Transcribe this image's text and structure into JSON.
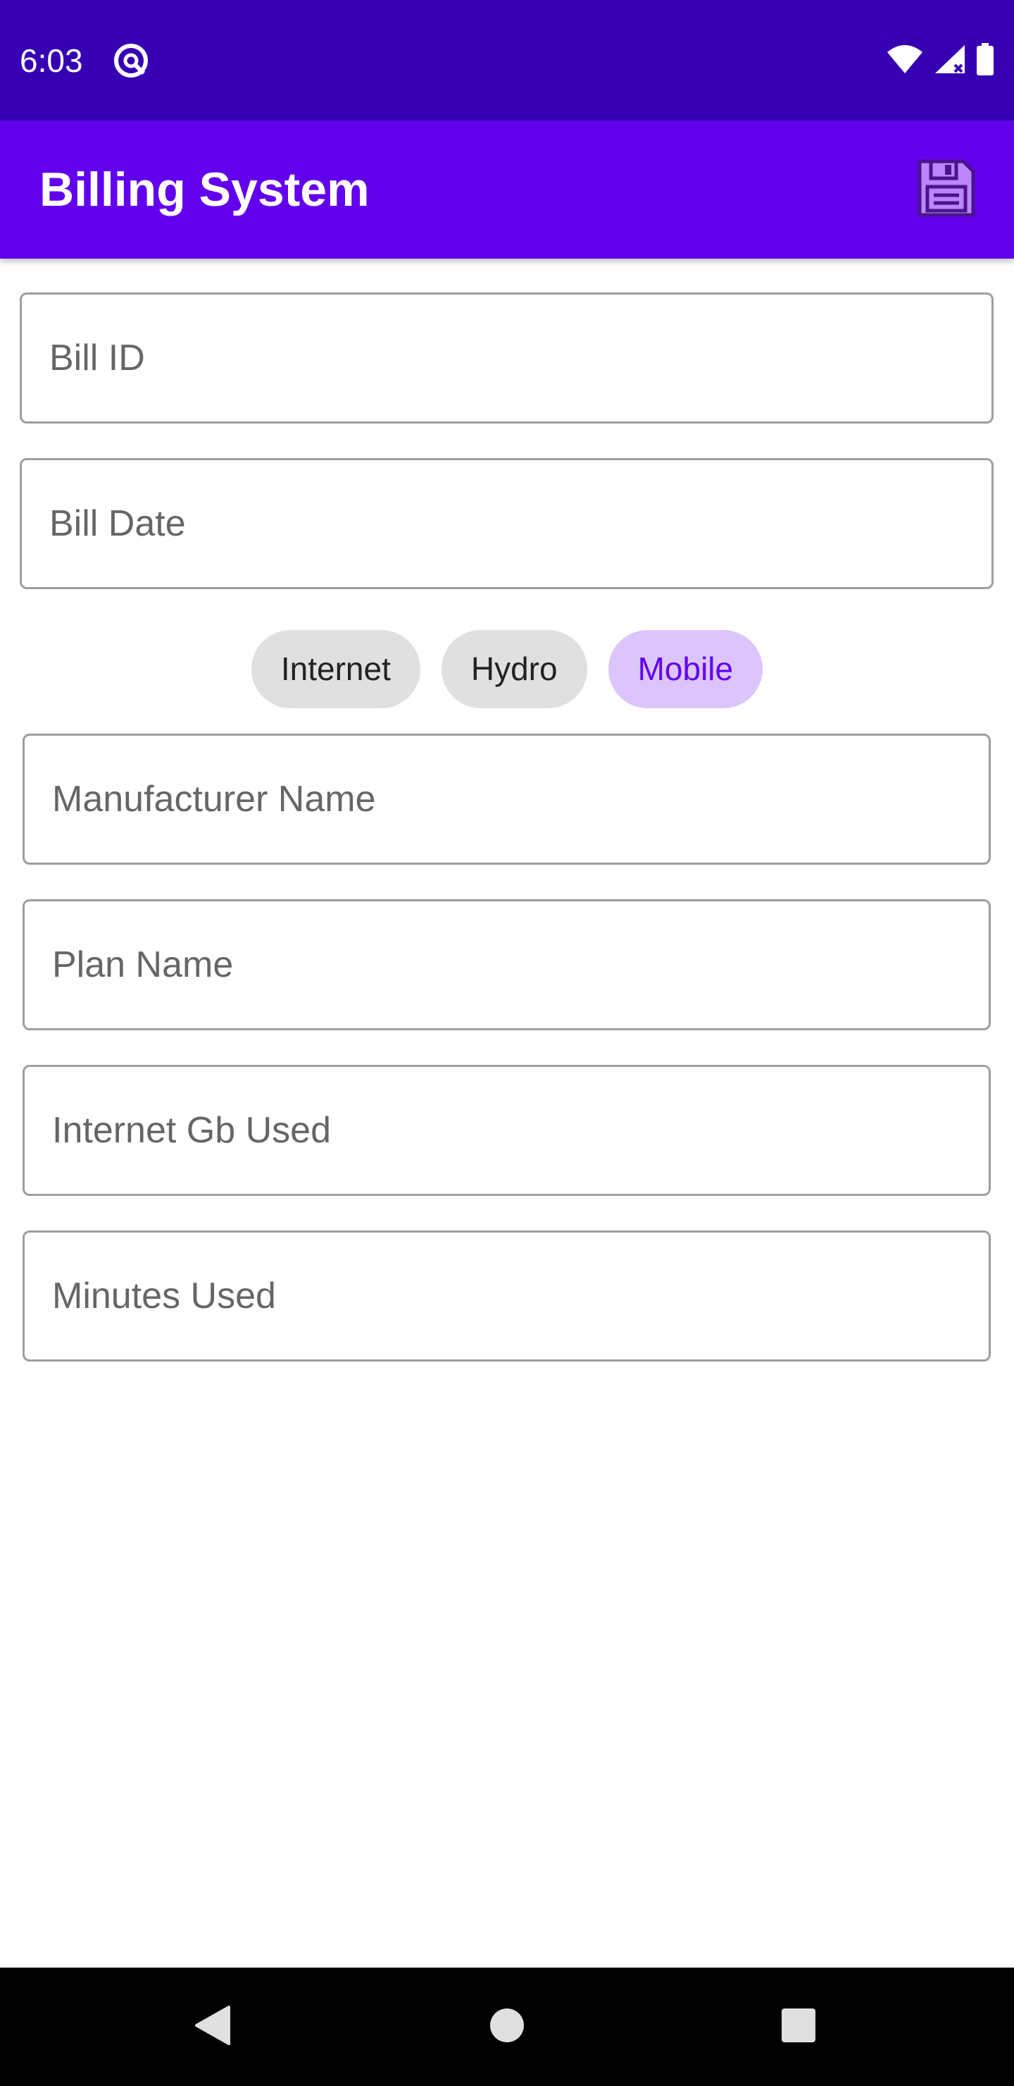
{
  "status_bar": {
    "time": "6:03"
  },
  "app_bar": {
    "title": "Billing System",
    "save_icon": "floppy-disk-save-icon"
  },
  "form": {
    "bill_id_placeholder": "Bill ID",
    "bill_date_placeholder": "Bill Date",
    "bill_types": [
      {
        "label": "Internet",
        "selected": false
      },
      {
        "label": "Hydro",
        "selected": false
      },
      {
        "label": "Mobile",
        "selected": true
      }
    ],
    "manufacturer_name_placeholder": "Manufacturer Name",
    "plan_name_placeholder": "Plan Name",
    "internet_gb_used_placeholder": "Internet Gb Used",
    "minutes_used_placeholder": "Minutes Used"
  },
  "colors": {
    "status_bar": "#3700b3",
    "app_bar": "#6200ee",
    "chip_selected_bg": "#dbc5fa",
    "chip_selected_text": "#6200ee",
    "chip_bg": "#e0e0e0",
    "save_icon": "#bb86fc"
  },
  "nav_bar": {
    "back_icon": "back-triangle-icon",
    "home_icon": "home-circle-icon",
    "recents_icon": "recents-square-icon"
  }
}
